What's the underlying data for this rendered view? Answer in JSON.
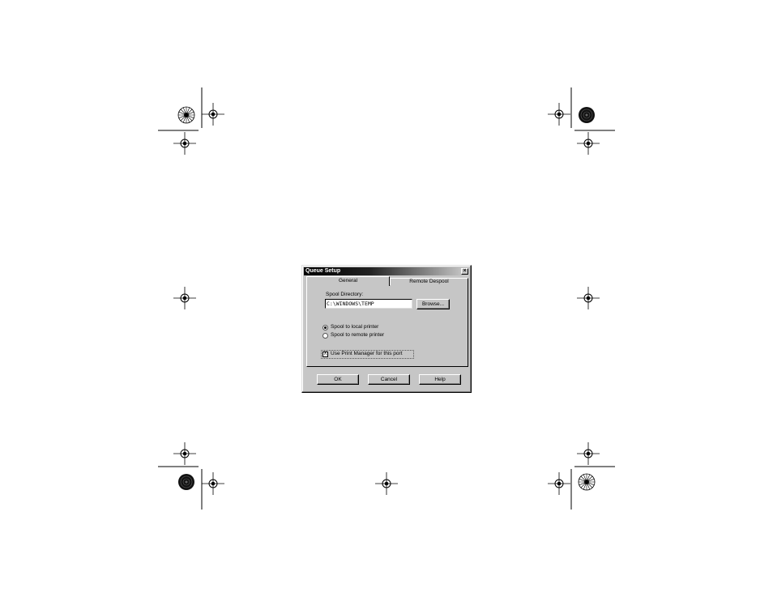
{
  "dialog": {
    "title": "Queue Setup",
    "close_label": "×",
    "tabs": {
      "general": "General",
      "remote": "Remote Despool"
    },
    "spool_directory": {
      "label": "Spool Directory:",
      "value": "C:\\WINDOWS\\TEMP"
    },
    "browse_label": "Browse...",
    "radio_local": {
      "label": "Spool to local printer",
      "selected": true
    },
    "radio_remote": {
      "label": "Spool to remote printer",
      "selected": false
    },
    "checkbox_print_manager": {
      "label": "Use Print Manager for this port",
      "checked": true,
      "mark": "X"
    },
    "buttons": {
      "ok": "OK",
      "cancel": "Cancel",
      "help": "Help"
    }
  },
  "decorations": {
    "registration_mark_icon": "crosshair-circle",
    "color_target_icon": "radial-starburst"
  }
}
